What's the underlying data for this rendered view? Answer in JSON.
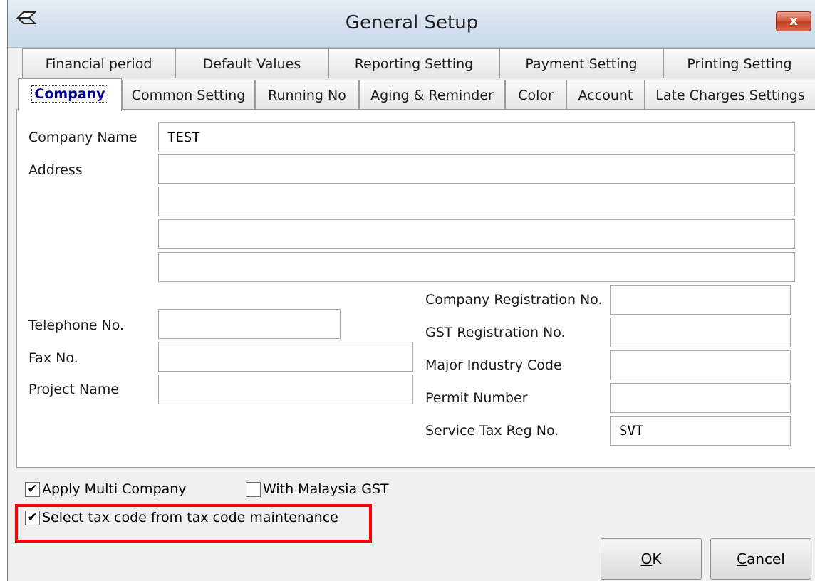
{
  "window": {
    "title": "General Setup",
    "close_label": "x"
  },
  "tabs_row1": [
    "Financial period",
    "Default Values",
    "Reporting Setting",
    "Payment Setting",
    "Printing Setting"
  ],
  "tabs_row2": [
    "Company",
    "Common Setting",
    "Running No",
    "Aging & Reminder",
    "Color",
    "Account",
    "Late Charges Settings"
  ],
  "active_tab": "Company",
  "form": {
    "company_name_label": "Company Name",
    "company_name_value": "TEST",
    "address_label": "Address",
    "address_lines": [
      "",
      "",
      "",
      ""
    ],
    "telephone_label": "Telephone No.",
    "telephone_value": "",
    "fax_label": "Fax No.",
    "fax_value": "",
    "project_label": "Project Name",
    "project_value": "",
    "company_reg_label": "Company Registration No.",
    "company_reg_value": "",
    "gst_reg_label": "GST Registration No.",
    "gst_reg_value": "",
    "industry_label": "Major Industry Code",
    "industry_value": "",
    "permit_label": "Permit Number",
    "permit_value": "",
    "service_tax_label": "Service Tax Reg No.",
    "service_tax_value": "SVT"
  },
  "options": {
    "apply_multi_company": {
      "label": "Apply Multi Company",
      "checked": true
    },
    "with_malaysia_gst": {
      "label": "With Malaysia GST",
      "checked": false
    },
    "select_tax_code": {
      "label": "Select tax code from tax code maintenance",
      "checked": true
    }
  },
  "buttons": {
    "ok_mnemonic": "O",
    "ok_rest": "K",
    "cancel_mnemonic": "C",
    "cancel_rest": "ancel"
  },
  "colors": {
    "highlight": "#ff0000",
    "active_tab_text": "#00008b",
    "titlebar": "#d4e0ee"
  }
}
